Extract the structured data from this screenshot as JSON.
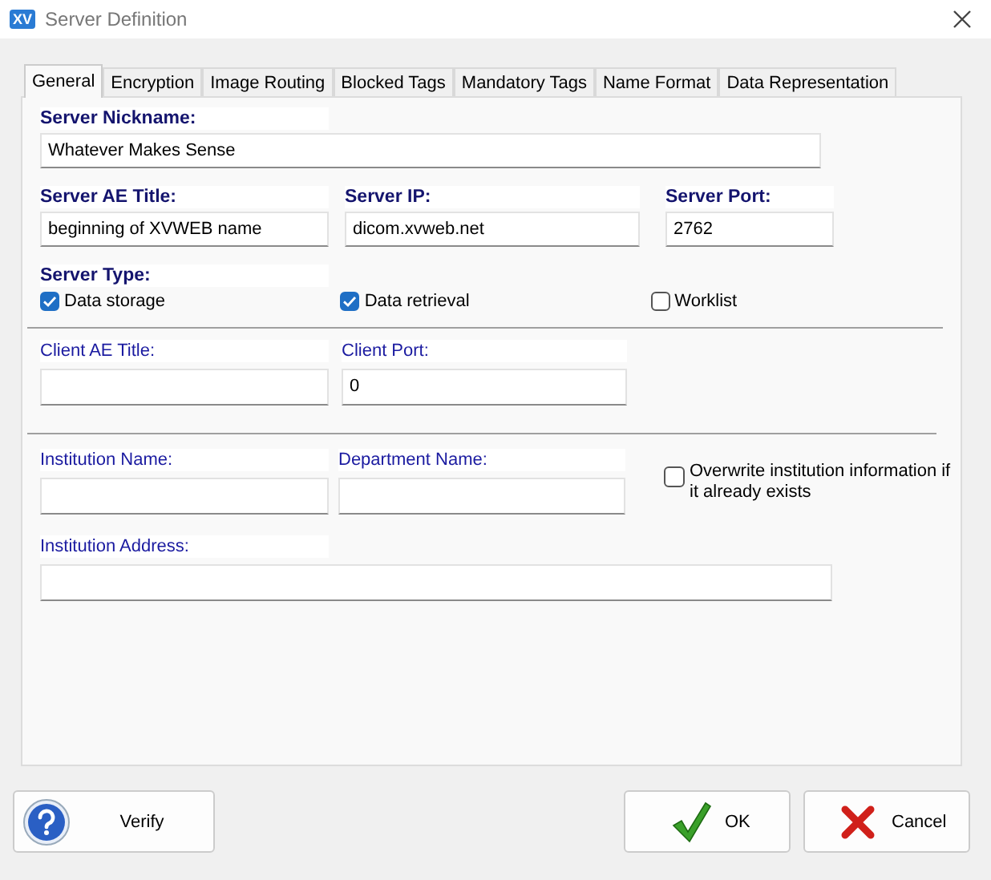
{
  "window": {
    "title": "Server Definition",
    "logo": "XV"
  },
  "tabs": [
    {
      "label": "General",
      "selected": true
    },
    {
      "label": "Encryption",
      "selected": false
    },
    {
      "label": "Image Routing",
      "selected": false
    },
    {
      "label": "Blocked Tags",
      "selected": false
    },
    {
      "label": "Mandatory Tags",
      "selected": false
    },
    {
      "label": "Name Format",
      "selected": false
    },
    {
      "label": "Data Representation",
      "selected": false
    }
  ],
  "nickname": {
    "label": "Server Nickname:",
    "value": "Whatever Makes Sense"
  },
  "server_fields": [
    {
      "label": "Server AE Title:",
      "value": "beginning of XVWEB name"
    },
    {
      "label": "Server IP:",
      "value": "dicom.xvweb.net"
    },
    {
      "label": "Server Port:",
      "value": "2762"
    }
  ],
  "server_type": {
    "label": "Server Type:",
    "options": [
      {
        "label": "Data storage",
        "checked": true
      },
      {
        "label": "Data retrieval",
        "checked": true
      },
      {
        "label": "Worklist",
        "checked": false
      }
    ]
  },
  "client_fields": [
    {
      "label": "Client AE Title:"
    },
    {
      "label": "Client Port:",
      "value": "0"
    }
  ],
  "institution_fields": [
    {
      "label": "Institution Name:"
    },
    {
      "label": "Department Name:"
    }
  ],
  "overwrite": {
    "label": "Overwrite institution information if it already exists",
    "checked": false
  },
  "address": {
    "label": "Institution Address:"
  },
  "buttons": {
    "verify": "Verify",
    "ok": "OK",
    "cancel": "Cancel"
  }
}
